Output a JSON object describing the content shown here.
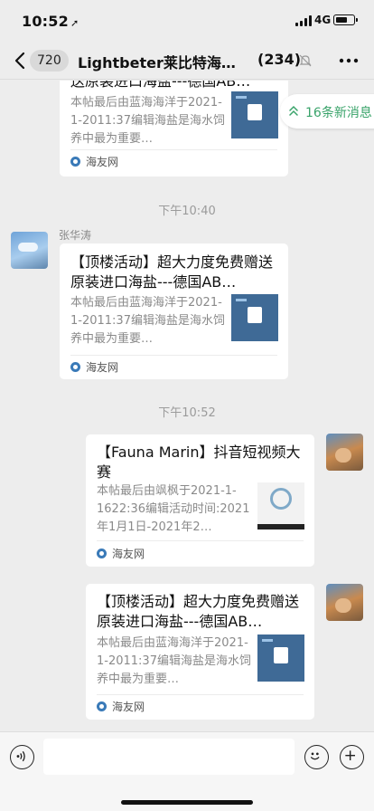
{
  "status_bar": {
    "time": "10:52",
    "network": "4G",
    "battery_level": 0.5
  },
  "header": {
    "unread_count": "720",
    "title": "Lightbeter莱比特海缸…",
    "member_count": "(234)"
  },
  "new_messages_label": "16条新消息",
  "messages": [
    {
      "title_lines": [
        "送原装进口海盐---德国AB…"
      ],
      "desc": "本帖最后由蓝海海洋于2021-1-2011:37编辑海盐是海水饲养中最为重要…",
      "source": "海友网"
    },
    {
      "timestamp": "下午10:40",
      "sender": "张华涛",
      "title": "【顶楼活动】超大力度免费赠送原装进口海盐---德国AB…",
      "desc": "本帖最后由蓝海海洋于2021-1-2011:37编辑海盐是海水饲养中最为重要…",
      "source": "海友网"
    },
    {
      "timestamp": "下午10:52",
      "title": "【Fauna Marin】抖音短视频大赛",
      "desc": "本帖最后由飒枫于2021-1-1622:36编辑活动时间:2021年1月1日-2021年2…",
      "source": "海友网"
    },
    {
      "title": "【顶楼活动】超大力度免费赠送原装进口海盐---德国AB…",
      "desc": "本帖最后由蓝海海洋于2021-1-2011:37编辑海盐是海水饲养中最为重要…",
      "source": "海友网"
    }
  ],
  "input": {
    "placeholder": ""
  },
  "colors": {
    "background": "#ededed",
    "accent_green": "#39a36a"
  },
  "icons": [
    "back-icon",
    "mute-icon",
    "more-icon",
    "voice-icon",
    "emoji-icon",
    "plus-icon",
    "double-chevron-up-icon"
  ]
}
